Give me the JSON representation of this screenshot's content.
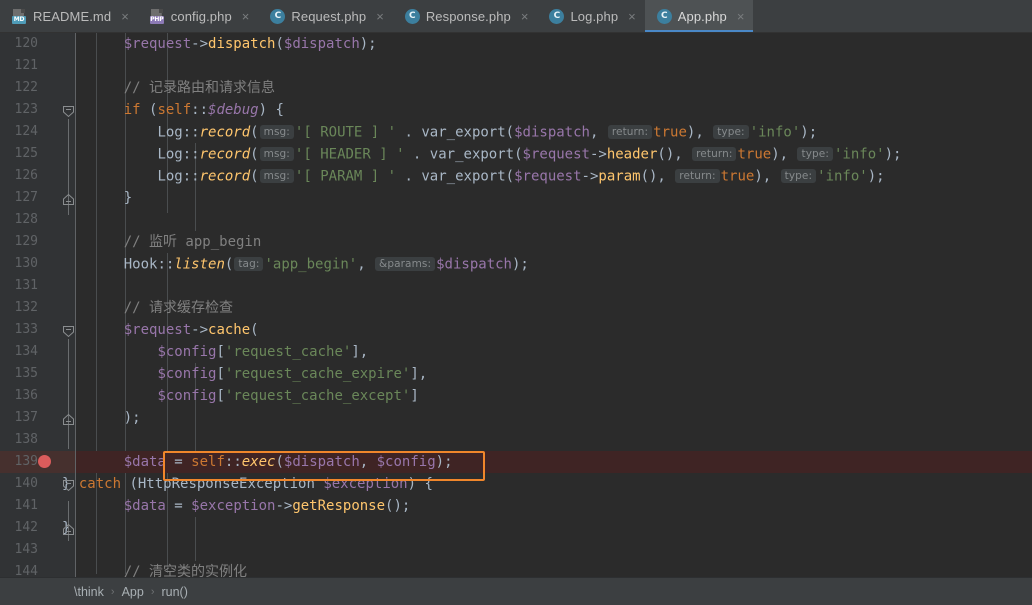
{
  "tabs": [
    {
      "label": "README.md",
      "icon": "markdown-file-icon",
      "badge": "MD",
      "active": false,
      "close": "×"
    },
    {
      "label": "config.php",
      "icon": "php-file-icon",
      "badge": "PHP",
      "active": false,
      "close": "×"
    },
    {
      "label": "Request.php",
      "icon": "php-class-icon",
      "badge": "C",
      "active": false,
      "close": "×"
    },
    {
      "label": "Response.php",
      "icon": "php-class-icon",
      "badge": "C",
      "active": false,
      "close": "×"
    },
    {
      "label": "Log.php",
      "icon": "php-class-icon",
      "badge": "C",
      "active": false,
      "close": "×"
    },
    {
      "label": "App.php",
      "icon": "php-class-icon",
      "badge": "C",
      "active": true,
      "close": "×"
    }
  ],
  "editor": {
    "first_line_number": 120,
    "last_line_number": 144,
    "line_height": 22,
    "highlighted_line": 139,
    "breakpoint_line": 139,
    "annotation": {
      "line": 139,
      "color": "#f0862b",
      "text": "$data = self::exec($dispatch, $config);"
    },
    "line_numbers": [
      "120",
      "121",
      "122",
      "123",
      "124",
      "125",
      "126",
      "127",
      "128",
      "129",
      "130",
      "131",
      "132",
      "133",
      "134",
      "135",
      "136",
      "137",
      "138",
      "139",
      "140",
      "141",
      "142",
      "143",
      "144"
    ],
    "lines": [
      {
        "n": "120",
        "text": "    $request->dispatch($dispatch);"
      },
      {
        "n": "121",
        "text": ""
      },
      {
        "n": "122",
        "text": "    // 记录路由和请求信息"
      },
      {
        "n": "123",
        "text": "    if (self::$debug) {"
      },
      {
        "n": "124",
        "text": "        Log::record( msg: '[ ROUTE ] ' . var_export($dispatch, return: true), type: 'info');"
      },
      {
        "n": "125",
        "text": "        Log::record( msg: '[ HEADER ] ' . var_export($request->header(), return: true), type: 'info');"
      },
      {
        "n": "126",
        "text": "        Log::record( msg: '[ PARAM ] ' . var_export($request->param(), return: true), type: 'info');"
      },
      {
        "n": "127",
        "text": "    }"
      },
      {
        "n": "128",
        "text": ""
      },
      {
        "n": "129",
        "text": "    // 监听 app_begin"
      },
      {
        "n": "130",
        "text": "    Hook::listen( tag: 'app_begin', &params: $dispatch);"
      },
      {
        "n": "131",
        "text": ""
      },
      {
        "n": "132",
        "text": "    // 请求缓存检查"
      },
      {
        "n": "133",
        "text": "    $request->cache("
      },
      {
        "n": "134",
        "text": "        $config['request_cache'],"
      },
      {
        "n": "135",
        "text": "        $config['request_cache_expire'],"
      },
      {
        "n": "136",
        "text": "        $config['request_cache_except']"
      },
      {
        "n": "137",
        "text": "    );"
      },
      {
        "n": "138",
        "text": ""
      },
      {
        "n": "139",
        "text": "    $data = self::exec($dispatch, $config);"
      },
      {
        "n": "140",
        "text": "} catch (HttpResponseException $exception) {"
      },
      {
        "n": "141",
        "text": "    $data = $exception->getResponse();"
      },
      {
        "n": "142",
        "text": "}"
      },
      {
        "n": "143",
        "text": ""
      },
      {
        "n": "144",
        "text": "    // 清空类的实例化"
      }
    ],
    "inlay_hints": [
      "msg:",
      "return:",
      "type:",
      "tag:",
      "&params:"
    ]
  },
  "breadcrumb": {
    "items": [
      "\\think",
      "App",
      "run()"
    ],
    "separator": "›"
  },
  "colors": {
    "editor_bg": "#2b2b2b",
    "gutter_bg": "#313335",
    "tabbar_bg": "#3c3f41",
    "active_tab_bg": "#4e5254",
    "active_tab_underline": "#4a88c7",
    "highlight_row": "#3f2424",
    "breakpoint": "#db5c5c",
    "annotation": "#f0862b",
    "keyword": "#cc7832",
    "variable": "#9876aa",
    "function": "#ffc66d",
    "string": "#6a8759",
    "comment": "#808080",
    "default_text": "#a9b7c6"
  }
}
